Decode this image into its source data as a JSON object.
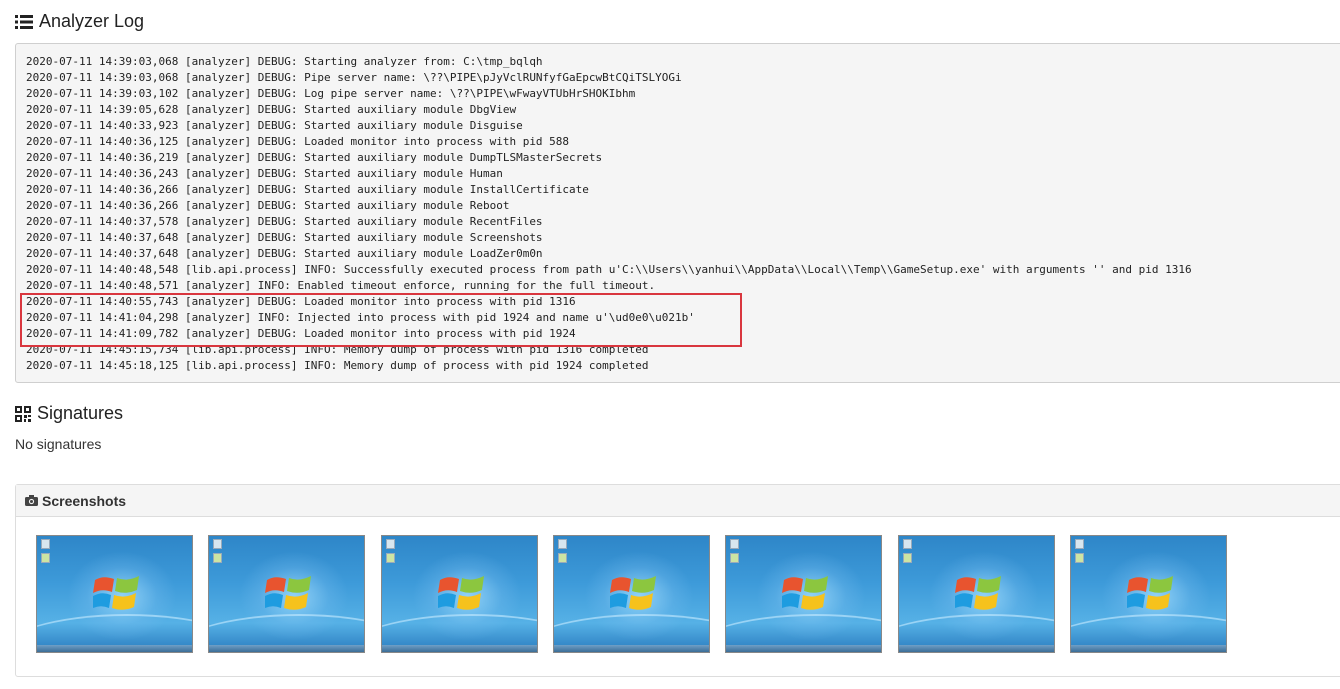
{
  "analyzer_log": {
    "title": "Analyzer Log",
    "lines": [
      "2020-07-11 14:39:03,068 [analyzer] DEBUG: Starting analyzer from: C:\\tmp_bqlqh",
      "2020-07-11 14:39:03,068 [analyzer] DEBUG: Pipe server name: \\??\\PIPE\\pJyVclRUNfyfGaEpcwBtCQiTSLYOGi",
      "2020-07-11 14:39:03,102 [analyzer] DEBUG: Log pipe server name: \\??\\PIPE\\wFwayVTUbHrSHOKIbhm",
      "2020-07-11 14:39:05,628 [analyzer] DEBUG: Started auxiliary module DbgView",
      "2020-07-11 14:40:33,923 [analyzer] DEBUG: Started auxiliary module Disguise",
      "2020-07-11 14:40:36,125 [analyzer] DEBUG: Loaded monitor into process with pid 588",
      "2020-07-11 14:40:36,219 [analyzer] DEBUG: Started auxiliary module DumpTLSMasterSecrets",
      "2020-07-11 14:40:36,243 [analyzer] DEBUG: Started auxiliary module Human",
      "2020-07-11 14:40:36,266 [analyzer] DEBUG: Started auxiliary module InstallCertificate",
      "2020-07-11 14:40:36,266 [analyzer] DEBUG: Started auxiliary module Reboot",
      "2020-07-11 14:40:37,578 [analyzer] DEBUG: Started auxiliary module RecentFiles",
      "2020-07-11 14:40:37,648 [analyzer] DEBUG: Started auxiliary module Screenshots",
      "2020-07-11 14:40:37,648 [analyzer] DEBUG: Started auxiliary module LoadZer0m0n",
      "2020-07-11 14:40:48,548 [lib.api.process] INFO: Successfully executed process from path u'C:\\\\Users\\\\yanhui\\\\AppData\\\\Local\\\\Temp\\\\GameSetup.exe' with arguments '' and pid 1316",
      "2020-07-11 14:40:48,571 [analyzer] INFO: Enabled timeout enforce, running for the full timeout.",
      "2020-07-11 14:40:55,743 [analyzer] DEBUG: Loaded monitor into process with pid 1316",
      "2020-07-11 14:41:04,298 [analyzer] INFO: Injected into process with pid 1924 and name u'\\ud0e0\\u021b'",
      "2020-07-11 14:41:09,782 [analyzer] DEBUG: Loaded monitor into process with pid 1924",
      "2020-07-11 14:45:15,734 [lib.api.process] INFO: Memory dump of process with pid 1316 completed",
      "2020-07-11 14:45:18,125 [lib.api.process] INFO: Memory dump of process with pid 1924 completed"
    ]
  },
  "signatures": {
    "title": "Signatures",
    "empty_text": "No signatures"
  },
  "screenshots": {
    "title": "Screenshots",
    "count": 7
  },
  "colors": {
    "highlight": "#d9363e",
    "log_bg": "#f5f5f5"
  },
  "icons": {
    "log_title": "list-icon",
    "signatures_title": "qrcode-icon",
    "screenshots_title": "camera-icon"
  }
}
